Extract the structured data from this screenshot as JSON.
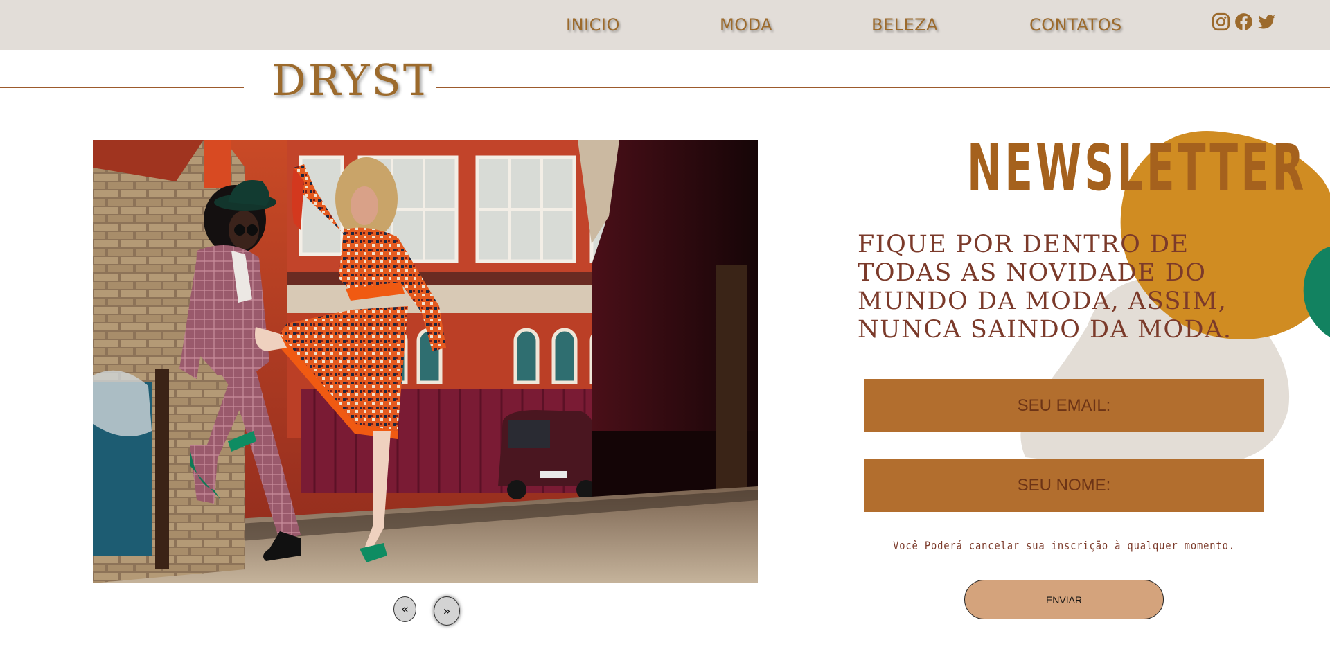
{
  "nav": {
    "links": [
      "INICIO",
      "MODA",
      "BELEZA",
      "CONTATOS"
    ],
    "social_icons": [
      "instagram-icon",
      "facebook-icon",
      "twitter-icon"
    ]
  },
  "brand": {
    "name": "DRYST"
  },
  "carousel": {
    "prev_label": "«",
    "next_label": "»"
  },
  "newsletter": {
    "title": "NEWSLETTER",
    "text": "FIQUE POR DENTRO DE TODAS AS NOVIDADE DO MUNDO DA MODA, ASSIM, NUNCA SAINDO DA MODA.",
    "email_placeholder": "SEU EMAIL:",
    "name_placeholder": "SEU NOME:",
    "note": "Você Poderá cancelar sua inscrição à qualquer momento.",
    "submit_label": "ENVIAR"
  },
  "colors": {
    "nav_bg": "#e2ddd8",
    "accent_brown": "#9c6a2c",
    "input_bg": "#b26e2e",
    "button_bg": "#d4a37c",
    "blob_mustard": "#d08c22",
    "blob_green": "#128260",
    "blob_grey": "#e3ddd6"
  }
}
